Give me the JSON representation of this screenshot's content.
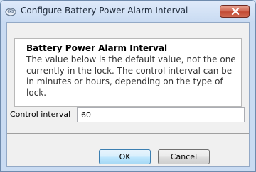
{
  "window": {
    "title": "Configure Battery Power Alarm Interval",
    "close_icon": "close-x-icon",
    "app_icon": "device-icon"
  },
  "info": {
    "heading": "Battery Power Alarm Interval",
    "description": "The value below is the default value, not the one currently in the lock. The control interval can be in minutes or hours, depending on the type of lock."
  },
  "form": {
    "control_interval_label": "Control interval",
    "control_interval_value": "60"
  },
  "buttons": {
    "ok_label": "OK",
    "cancel_label": "Cancel"
  },
  "colors": {
    "title_bar": "#c9dbf2",
    "close_button": "#c24a34",
    "ok_button_border": "#3c7fb1"
  }
}
